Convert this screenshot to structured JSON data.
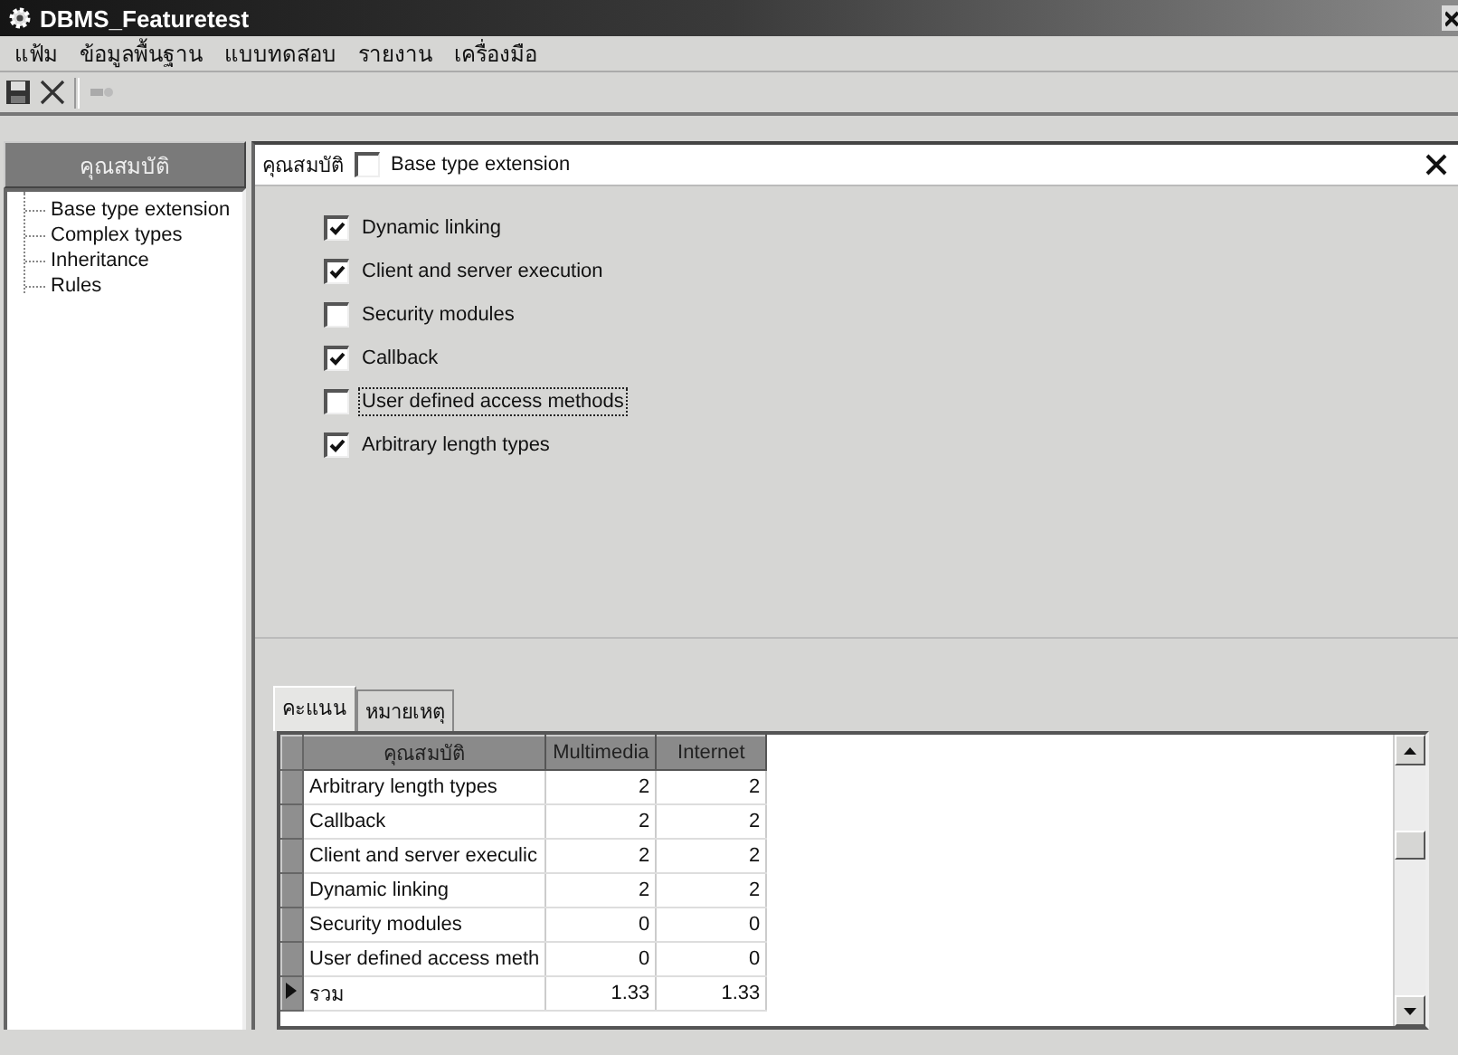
{
  "window": {
    "title": "DBMS_Featuretest"
  },
  "menu": [
    "แฟ้ม",
    "ข้อมูลพื้นฐาน",
    "แบบทดสอบ",
    "รายงาน",
    "เครื่องมือ"
  ],
  "sidebar": {
    "header": "คุณสมบัติ",
    "items": [
      "Base type extension",
      "Complex types",
      "Inheritance",
      "Rules"
    ]
  },
  "properties": {
    "label": "คุณสมบัติ",
    "category": {
      "label": "Base type extension",
      "checked": false
    },
    "options": [
      {
        "label": "Dynamic linking",
        "checked": true,
        "focused": false
      },
      {
        "label": "Client and server execution",
        "checked": true,
        "focused": false
      },
      {
        "label": "Security modules",
        "checked": false,
        "focused": false
      },
      {
        "label": "Callback",
        "checked": true,
        "focused": false
      },
      {
        "label": "User defined access methods",
        "checked": false,
        "focused": true
      },
      {
        "label": "Arbitrary length types",
        "checked": true,
        "focused": false
      }
    ]
  },
  "tabs": [
    {
      "label": "คะแนน",
      "selected": true
    },
    {
      "label": "หมายเหตุ",
      "selected": false
    }
  ],
  "grid": {
    "columns": [
      "คุณสมบัติ",
      "Multimedia",
      "Internet"
    ],
    "rows": [
      {
        "cells": [
          "Arbitrary length types",
          "2",
          "2"
        ],
        "current": false
      },
      {
        "cells": [
          "Callback",
          "2",
          "2"
        ],
        "current": false
      },
      {
        "cells": [
          "Client and server execulic",
          "2",
          "2"
        ],
        "current": false
      },
      {
        "cells": [
          "Dynamic linking",
          "2",
          "2"
        ],
        "current": false
      },
      {
        "cells": [
          "Security modules",
          "0",
          "0"
        ],
        "current": false
      },
      {
        "cells": [
          "User defined access meth",
          "0",
          "0"
        ],
        "current": false
      },
      {
        "cells": [
          "รวม",
          "1.33",
          "1.33"
        ],
        "current": true
      }
    ]
  }
}
